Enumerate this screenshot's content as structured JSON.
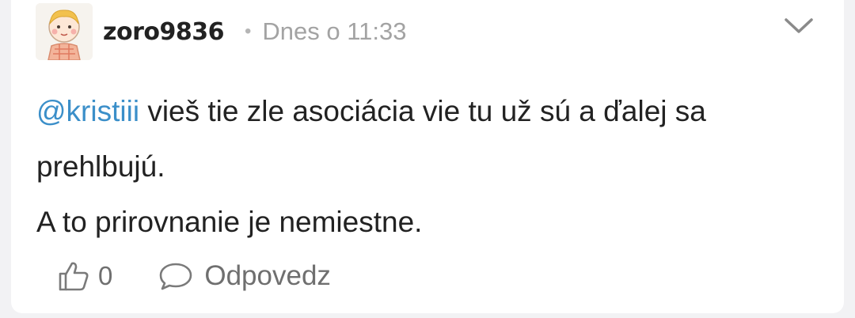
{
  "comment": {
    "author": "zoro9836",
    "separator": "•",
    "timestamp": "Dnes o 11:33",
    "mention": "@kristiii",
    "line1_rest": " vieš tie zle asociácia vie tu už sú a ďalej sa prehlbujú.",
    "line2": "A to prirovnanie je nemiestne.",
    "likes": "0",
    "reply_label": "Odpovedz"
  },
  "icons": {
    "avatar": "child-cartoon-avatar",
    "menu": "chevron-down-icon",
    "like": "thumbs-up-icon",
    "reply": "speech-bubble-icon"
  },
  "colors": {
    "mention": "#3b8fc9",
    "text": "#222222",
    "muted": "#a3a3a3",
    "action": "#6f6f6f"
  }
}
